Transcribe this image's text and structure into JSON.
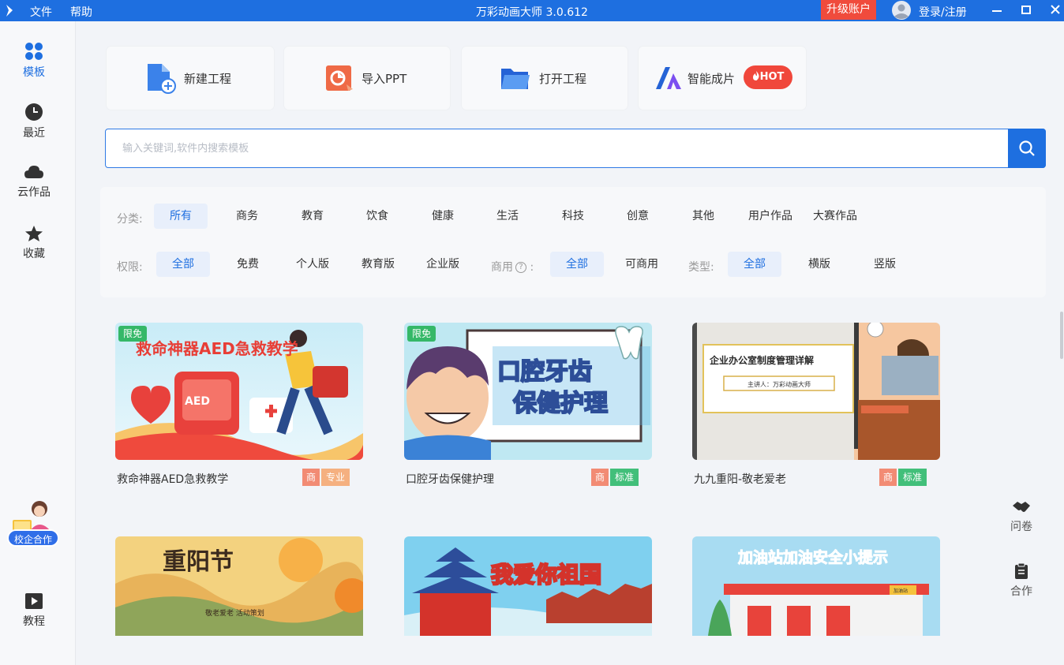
{
  "titlebar": {
    "menu": [
      "文件",
      "帮助"
    ],
    "title": "万彩动画大师 3.0.612",
    "upgrade": "升级账户",
    "login": "登录/注册",
    "bg_color": "#1e6fe0"
  },
  "sidebar": {
    "items": [
      {
        "label": "模板",
        "icon": "grid-icon",
        "active": true
      },
      {
        "label": "最近",
        "icon": "clock-icon"
      },
      {
        "label": "云作品",
        "icon": "cloud-icon"
      },
      {
        "label": "收藏",
        "icon": "star-icon"
      }
    ],
    "cooperation": "校企合作",
    "tutorial": "教程"
  },
  "quick_actions": [
    {
      "label": "新建工程",
      "icon": "new-file-icon"
    },
    {
      "label": "导入PPT",
      "icon": "ppt-icon"
    },
    {
      "label": "打开工程",
      "icon": "folder-icon"
    },
    {
      "label": "智能成片",
      "icon": "ai-logo-icon",
      "badge": "HOT"
    }
  ],
  "search": {
    "placeholder": "输入关键词,软件内搜索模板"
  },
  "filters": {
    "category_label": "分类:",
    "categories": [
      "所有",
      "商务",
      "教育",
      "饮食",
      "健康",
      "生活",
      "科技",
      "创意",
      "其他",
      "用户作品",
      "大赛作品"
    ],
    "category_selected": "所有",
    "permission_label": "权限:",
    "permissions": [
      "全部",
      "免费",
      "个人版",
      "教育版",
      "企业版"
    ],
    "commercial_label": "商用",
    "commercial_sep": ":",
    "commercial": [
      "全部",
      "可商用"
    ],
    "type_label": "类型:",
    "types": [
      "全部",
      "横版",
      "竖版"
    ]
  },
  "templates": [
    {
      "name": "救命神器AED急救教学",
      "badge": "限免",
      "tags": [
        "商",
        "专业"
      ],
      "title_text": "救命神器AED急救教学",
      "sub_text": "AED"
    },
    {
      "name": "口腔牙齿保健护理",
      "badge": "限免",
      "tags": [
        "商",
        "标准"
      ],
      "title_text": "口腔牙齿",
      "sub_text": "保健护理"
    },
    {
      "name": "九九重阳-敬老爱老",
      "tags": [
        "商",
        "标准"
      ],
      "title_text": "企业办公室制度管理详解",
      "sub_text": "主讲人：万彩动画大师"
    },
    {
      "name": "",
      "title_text": "重阳节",
      "sub_text": "敬老爱老 活动策划"
    },
    {
      "name": "",
      "title_text": "我爱你祖国"
    },
    {
      "name": "",
      "title_text": "加油站加油安全小提示",
      "sub_text": "加油站"
    }
  ],
  "right_tools": [
    {
      "label": "问卷",
      "icon": "handshake-icon"
    },
    {
      "label": "合作",
      "icon": "clipboard-icon"
    }
  ],
  "colors": {
    "accent": "#1e6fe0",
    "hot": "#f0473b",
    "free": "#35b868",
    "commercial": "#f28b74",
    "pro": "#f5b080",
    "standard": "#42bf7a"
  }
}
